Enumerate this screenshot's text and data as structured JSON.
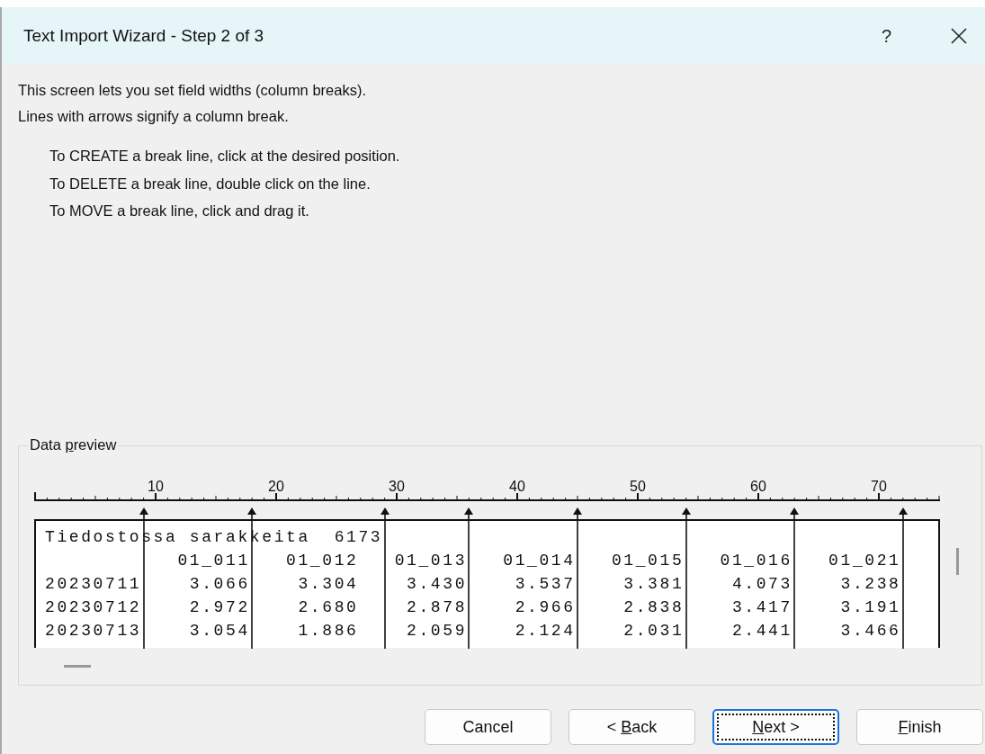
{
  "window": {
    "title": "Text Import Wizard - Step 2 of 3",
    "help": "?"
  },
  "intro": [
    "This screen lets you set field widths (column breaks).",
    "Lines with arrows signify a column break."
  ],
  "instructions": [
    "To CREATE a break line, click at the desired position.",
    "To DELETE a break line, double click on the line.",
    "To MOVE a break line, click and drag it."
  ],
  "preview": {
    "label_parts": [
      {
        "text": "Data ",
        "underlined": false
      },
      {
        "text": "p",
        "underlined": true
      },
      {
        "text": "review",
        "underlined": false
      }
    ],
    "ruler_labels": [
      "10",
      "20",
      "30",
      "40",
      "50",
      "60",
      "70"
    ],
    "ruler_positions": [
      {
        "break": false
      },
      {
        "break": false
      },
      {
        "break": false
      },
      {
        "break": false
      },
      {
        "break": false
      },
      {
        "break": false
      },
      {
        "break": false
      },
      {
        "break": false
      },
      {
        "break": false
      },
      {
        "break": true
      },
      {
        "break": false
      },
      {
        "break": false
      },
      {
        "break": false
      },
      {
        "break": false
      },
      {
        "break": false
      },
      {
        "break": false
      },
      {
        "break": false
      },
      {
        "break": false
      },
      {
        "break": true
      },
      {
        "break": false
      },
      {
        "break": false
      },
      {
        "break": false
      },
      {
        "break": false
      },
      {
        "break": false
      },
      {
        "break": false
      },
      {
        "break": false
      },
      {
        "break": false
      },
      {
        "break": false
      },
      {
        "break": false
      },
      {
        "break": true
      },
      {
        "break": false
      },
      {
        "break": false
      },
      {
        "break": false
      },
      {
        "break": false
      },
      {
        "break": false
      },
      {
        "break": false
      },
      {
        "break": true
      },
      {
        "break": false
      },
      {
        "break": false
      },
      {
        "break": false
      },
      {
        "break": false
      },
      {
        "break": false
      },
      {
        "break": false
      },
      {
        "break": false
      },
      {
        "break": false
      },
      {
        "break": true
      },
      {
        "break": false
      },
      {
        "break": false
      },
      {
        "break": false
      },
      {
        "break": false
      },
      {
        "break": false
      },
      {
        "break": false
      },
      {
        "break": false
      },
      {
        "break": false
      },
      {
        "break": true
      },
      {
        "break": false
      },
      {
        "break": false
      },
      {
        "break": false
      },
      {
        "break": false
      },
      {
        "break": false
      },
      {
        "break": false
      },
      {
        "break": false
      },
      {
        "break": false
      },
      {
        "break": true
      },
      {
        "break": false
      },
      {
        "break": false
      },
      {
        "break": false
      },
      {
        "break": false
      },
      {
        "break": false
      },
      {
        "break": false
      },
      {
        "break": false
      },
      {
        "break": false
      },
      {
        "break": true
      },
      {
        "break": false
      },
      {
        "break": false
      },
      {
        "break": false
      }
    ],
    "lines": [
      "Tiedostossa sarakkeita  6173",
      "           01_011   01_012   01_013   01_014   01_015   01_016   01_021",
      "20230711    3.066    3.304    3.430    3.537    3.381    4.073    3.238",
      "20230712    2.972    2.680    2.878    2.966    2.838    3.417    3.191",
      "20230713    3.054    1.886    2.059    2.124    2.031    2.441    3.466"
    ]
  },
  "buttons": [
    {
      "label_parts": [
        {
          "text": "Cancel",
          "underlined": false
        }
      ],
      "default": false
    },
    {
      "label_parts": [
        {
          "text": "< ",
          "underlined": false
        },
        {
          "text": "B",
          "underlined": true
        },
        {
          "text": "ack",
          "underlined": false
        }
      ],
      "default": false
    },
    {
      "label_parts": [
        {
          "text": "N",
          "underlined": true
        },
        {
          "text": "ext >",
          "underlined": false
        }
      ],
      "default": true
    },
    {
      "label_parts": [
        {
          "text": "F",
          "underlined": true
        },
        {
          "text": "inish",
          "underlined": false
        }
      ],
      "default": false
    }
  ]
}
